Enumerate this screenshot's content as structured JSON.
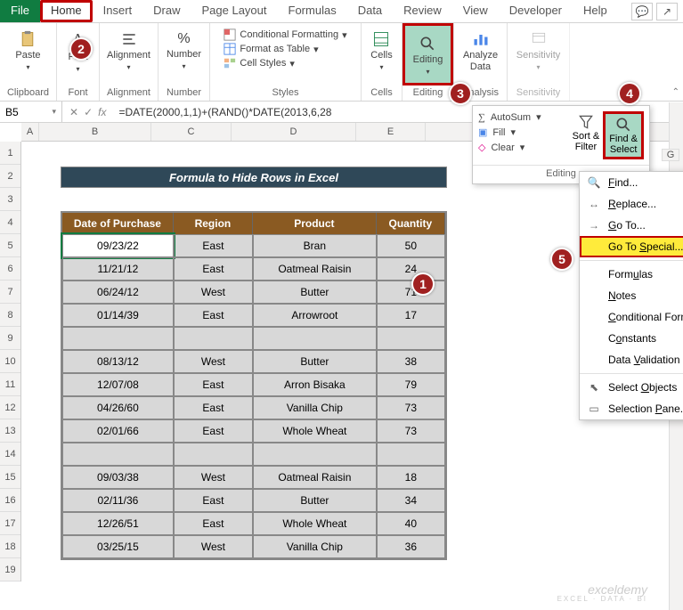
{
  "tabs": {
    "file": "File",
    "home": "Home",
    "insert": "Insert",
    "draw": "Draw",
    "page_layout": "Page Layout",
    "formulas": "Formulas",
    "data": "Data",
    "review": "Review",
    "view": "View",
    "developer": "Developer",
    "help": "Help"
  },
  "ribbon": {
    "clipboard": {
      "paste": "Paste",
      "label": "Clipboard"
    },
    "font": {
      "btn": "Font",
      "label": "Font"
    },
    "alignment": {
      "btn": "Alignment",
      "label": "Alignment"
    },
    "number": {
      "btn": "Number",
      "label": "Number"
    },
    "styles": {
      "cf": "Conditional Formatting",
      "fat": "Format as Table",
      "cs": "Cell Styles",
      "label": "Styles"
    },
    "cells": {
      "btn": "Cells",
      "label": "Cells"
    },
    "editing": {
      "btn": "Editing",
      "label": "Editing"
    },
    "analysis": {
      "btn": "Analyze\nData",
      "label": "Analysis"
    },
    "sensitivity": {
      "btn": "Sensitivity",
      "label": "Sensitivity"
    }
  },
  "namebox": "B5",
  "formula": "=DATE(2000,1,1)+(RAND()*DATE(2013,6,28",
  "cols": [
    "A",
    "B",
    "C",
    "D",
    "E"
  ],
  "rows": [
    "1",
    "2",
    "3",
    "4",
    "5",
    "6",
    "7",
    "8",
    "9",
    "10",
    "11",
    "12",
    "13",
    "14",
    "15",
    "16",
    "17",
    "18",
    "19"
  ],
  "title": "Formula to Hide Rows in Excel",
  "headers": {
    "date": "Date of Purchase",
    "region": "Region",
    "product": "Product",
    "qty": "Quantity"
  },
  "data": [
    {
      "d": "09/23/22",
      "r": "East",
      "p": "Bran",
      "q": "50",
      "sel": true
    },
    {
      "d": "11/21/12",
      "r": "East",
      "p": "Oatmeal Raisin",
      "q": "24"
    },
    {
      "d": "06/24/12",
      "r": "West",
      "p": "Butter",
      "q": "71"
    },
    {
      "d": "01/14/39",
      "r": "East",
      "p": "Arrowroot",
      "q": "17"
    },
    {
      "blank": true
    },
    {
      "d": "08/13/12",
      "r": "West",
      "p": "Butter",
      "q": "38"
    },
    {
      "d": "12/07/08",
      "r": "East",
      "p": "Arron Bisaka",
      "q": "79"
    },
    {
      "d": "04/26/60",
      "r": "East",
      "p": "Vanilla Chip",
      "q": "73"
    },
    {
      "d": "02/01/66",
      "r": "East",
      "p": "Whole Wheat",
      "q": "73"
    },
    {
      "blank": true
    },
    {
      "d": "09/03/38",
      "r": "West",
      "p": "Oatmeal Raisin",
      "q": "18"
    },
    {
      "d": "02/11/36",
      "r": "East",
      "p": "Butter",
      "q": "34"
    },
    {
      "d": "12/26/51",
      "r": "East",
      "p": "Whole Wheat",
      "q": "40"
    },
    {
      "d": "03/25/15",
      "r": "West",
      "p": "Vanilla Chip",
      "q": "36"
    }
  ],
  "editing_popup": {
    "autosum": "AutoSum",
    "fill": "Fill",
    "clear": "Clear",
    "sort": "Sort &\nFilter",
    "find": "Find &\nSelect",
    "label": "Editing",
    "extra_col": "G"
  },
  "menu": {
    "find": "Find...",
    "replace": "Replace...",
    "goto": "Go To...",
    "special": "Go To Special...",
    "formulas": "Formulas",
    "notes": "Notes",
    "cond": "Conditional Form",
    "constants": "Constants",
    "dv": "Data Validation",
    "selobj": "Select Objects",
    "selpane": "Selection Pane..."
  },
  "callouts": {
    "c1": "1",
    "c2": "2",
    "c3": "3",
    "c4": "4",
    "c5": "5"
  },
  "watermark": {
    "main": "exceldemy",
    "sub": "EXCEL · DATA · BI"
  }
}
